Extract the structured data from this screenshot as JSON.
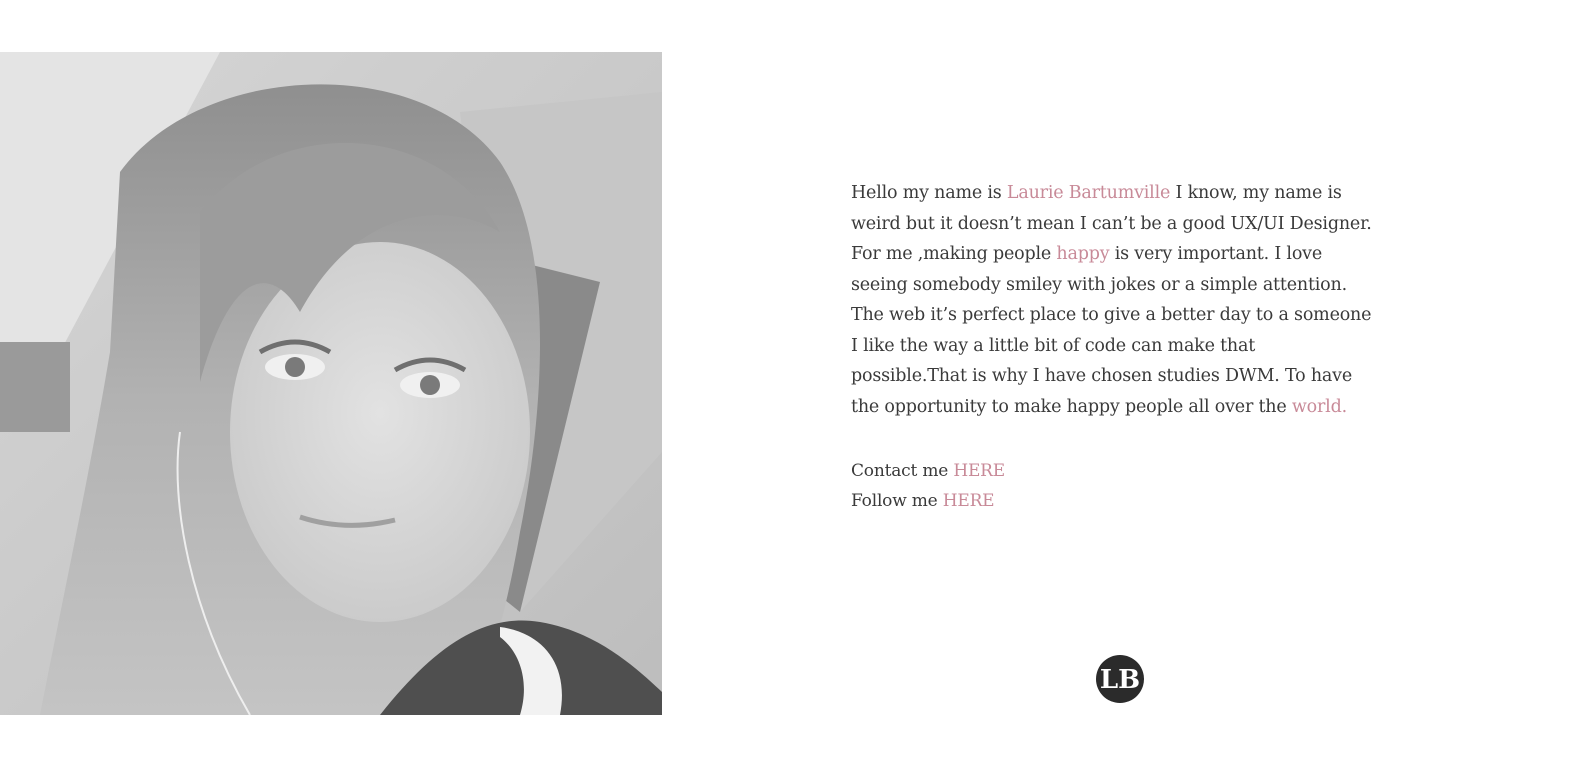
{
  "photo": {
    "icon": "portrait-photo"
  },
  "bio": {
    "line1": {
      "pre": "Hello my name is ",
      "name": "Laurie Bartumville",
      "post": " I know, my name is"
    },
    "line2": "weird but it doesn’t mean I can’t be a good UX/UI Designer.",
    "line3": {
      "pre": "For me ,making people ",
      "word": "happy",
      "post": " is very important. I love"
    },
    "line4": "seeing somebody smiley with jokes or a simple attention.",
    "line5": "The web it’s perfect place to give a better day to a someone",
    "line6": "I like the way a little bit of code can make that",
    "line7": "possible.That is why I have chosen studies DWM. To have",
    "line8": {
      "pre": "the opportunity to make happy people all over the ",
      "word": "world."
    }
  },
  "contacts": {
    "contact_label": "Contact me ",
    "contact_link": "HERE",
    "follow_label": "Follow me ",
    "follow_link": "HERE"
  },
  "logo": {
    "text": "LB",
    "icon": "lb-monogram-logo"
  },
  "colors": {
    "accent": "#c88a98",
    "text": "#3a3a3a",
    "logo": "#2b2b2b",
    "background": "#ffffff"
  }
}
